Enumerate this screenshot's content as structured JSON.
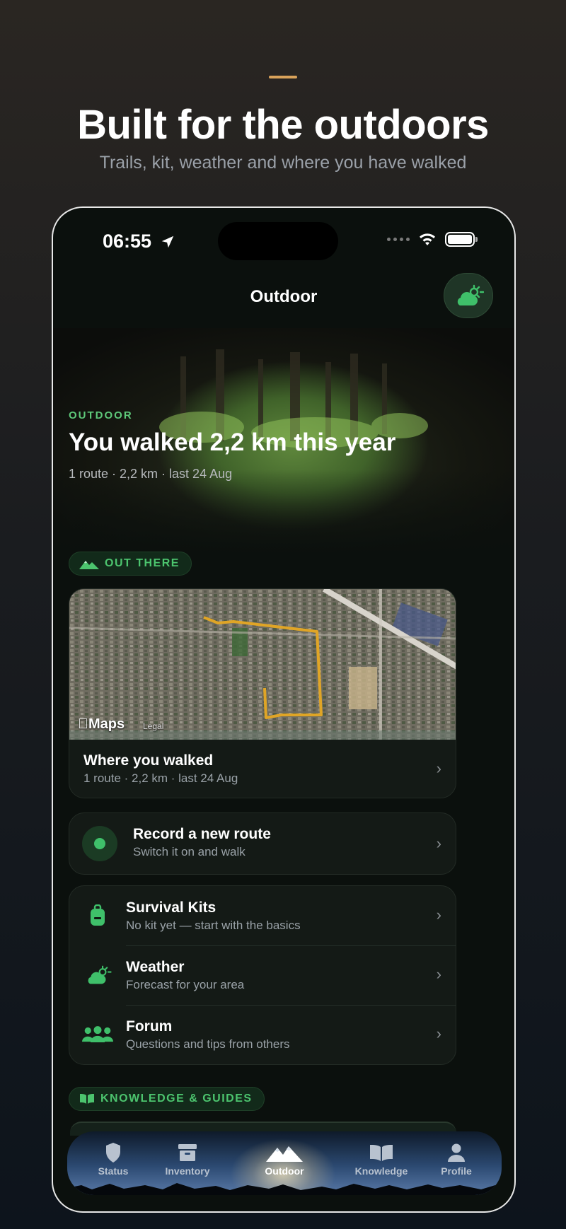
{
  "promo": {
    "headline": "Built for the outdoors",
    "subhead": "Trails, kit, weather and where you have walked"
  },
  "status_bar": {
    "time": "06:55"
  },
  "nav": {
    "title": "Outdoor",
    "weather_button_icon": "partly-sunny-icon"
  },
  "hero": {
    "eyebrow": "OUTDOOR",
    "title": "You walked 2,2 km this year",
    "meta": "1 route · 2,2 km · last 24 Aug"
  },
  "out_there": {
    "label": "OUT THERE",
    "map_card": {
      "maps_label": "Maps",
      "legal_label": "Legal",
      "title": "Where you walked",
      "subtitle": "1 route · 2,2 km · last 24 Aug"
    },
    "record_card": {
      "title": "Record a new route",
      "subtitle": "Switch it on and walk"
    },
    "list": [
      {
        "icon": "backpack-icon",
        "title": "Survival Kits",
        "subtitle": "No kit yet — start with the basics"
      },
      {
        "icon": "weather-icon",
        "title": "Weather",
        "subtitle": "Forecast for your area"
      },
      {
        "icon": "people-icon",
        "title": "Forum",
        "subtitle": "Questions and tips from others"
      }
    ]
  },
  "knowledge": {
    "label": "KNOWLEDGE & GUIDES"
  },
  "tabbar": {
    "active": "Outdoor",
    "tabs": [
      {
        "label": "Status",
        "icon": "shield-icon"
      },
      {
        "label": "Inventory",
        "icon": "archive-box-icon"
      },
      {
        "label": "Outdoor",
        "icon": "mountains-icon"
      },
      {
        "label": "Knowledge",
        "icon": "book-icon"
      },
      {
        "label": "Profile",
        "icon": "person-icon"
      }
    ]
  },
  "colors": {
    "accent_green": "#4cc46e",
    "accent_gold": "#d9a25a",
    "route_line": "#e0a526",
    "background": "#0b100d"
  }
}
